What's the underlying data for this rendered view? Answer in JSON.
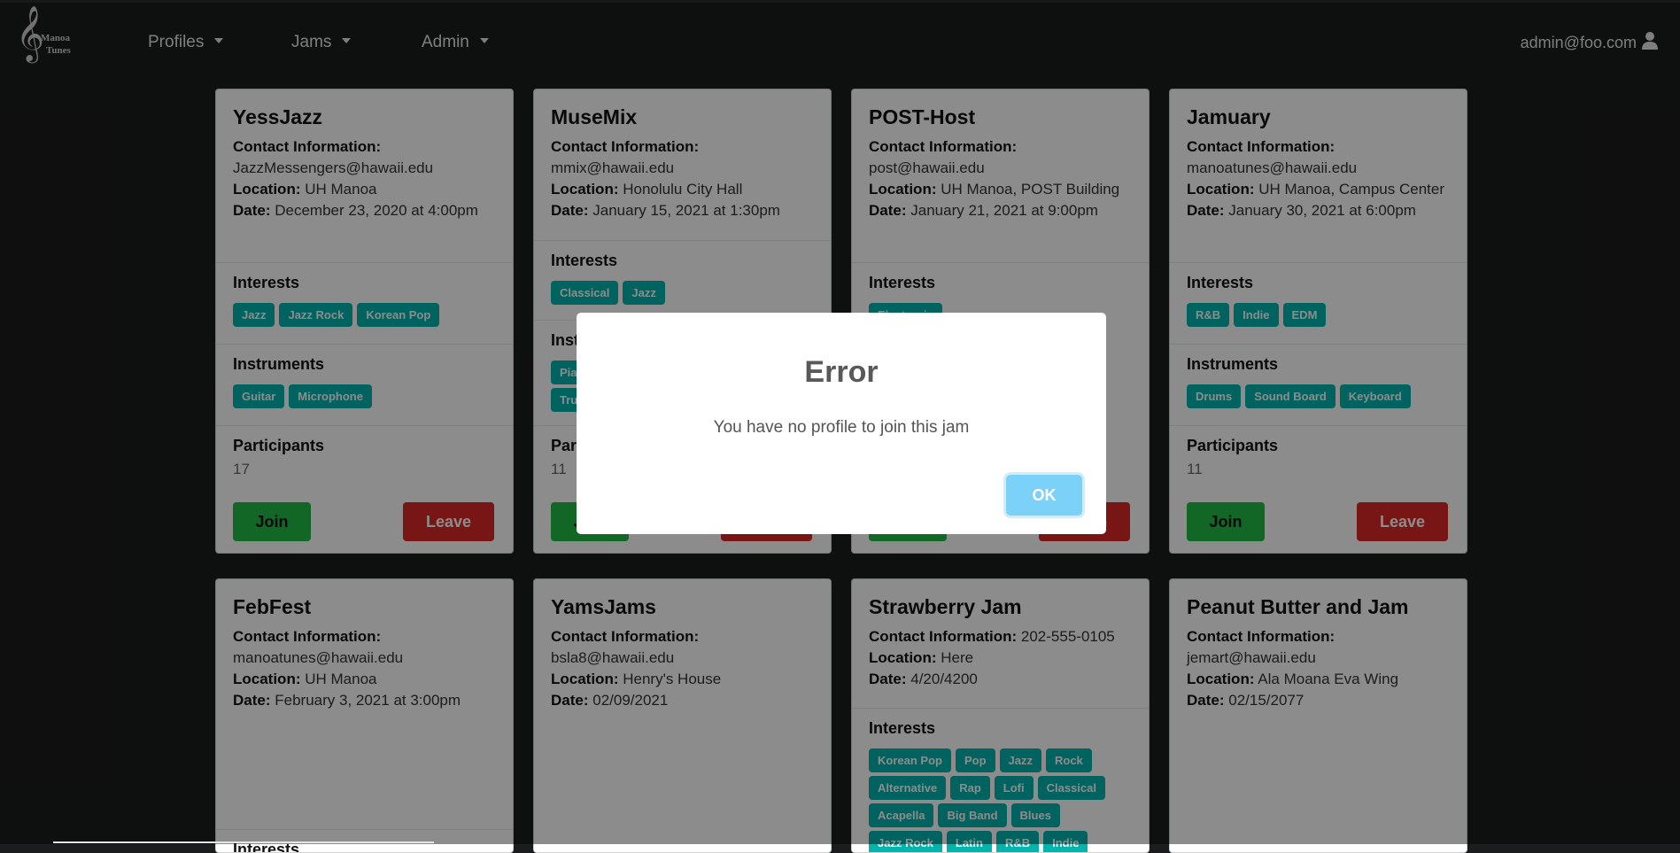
{
  "nav": {
    "logo_line1": "Manoa",
    "logo_line2": "Tunes",
    "items": [
      "Profiles",
      "Jams",
      "Admin"
    ],
    "user": "admin@foo.com"
  },
  "labels": {
    "contact": "Contact Information:",
    "location": "Location:",
    "date": "Date:",
    "interests": "Interests",
    "instruments": "Instruments",
    "participants": "Participants",
    "join": "Join",
    "leave": "Leave"
  },
  "jams": [
    {
      "name": "YessJazz",
      "contact": "JazzMessengers@hawaii.edu",
      "location": "UH Manoa",
      "date": "December 23, 2020 at 4:00pm",
      "interests": [
        "Jazz",
        "Jazz Rock",
        "Korean Pop"
      ],
      "instruments": [
        "Guitar",
        "Microphone"
      ],
      "participants": "17"
    },
    {
      "name": "MuseMix",
      "contact": "mmix@hawaii.edu",
      "location": "Honolulu City Hall",
      "date": "January 15, 2021 at 1:30pm",
      "interests": [
        "Classical",
        "Jazz"
      ],
      "instruments": [
        "Piano",
        "Trumpet"
      ],
      "participants": "11"
    },
    {
      "name": "POST-Host",
      "contact": "post@hawaii.edu",
      "location": "UH Manoa, POST Building",
      "date": "January 21, 2021 at 9:00pm",
      "interests": [
        "Electronic"
      ],
      "instruments": [],
      "participants": ""
    },
    {
      "name": "Jamuary",
      "contact": "manoatunes@hawaii.edu",
      "location": "UH Manoa, Campus Center",
      "date": "January 30, 2021 at 6:00pm",
      "interests": [
        "R&B",
        "Indie",
        "EDM"
      ],
      "instruments": [
        "Drums",
        "Sound Board",
        "Keyboard"
      ],
      "participants": "11"
    },
    {
      "name": "FebFest",
      "contact": "manoatunes@hawaii.edu",
      "location": "UH Manoa",
      "date": "February 3, 2021 at 3:00pm",
      "interests": []
    },
    {
      "name": "YamsJams",
      "contact": "bsla8@hawaii.edu",
      "location": "Henry's House",
      "date": "02/09/2021",
      "interests": []
    },
    {
      "name": "Strawberry Jam",
      "contact": "202-555-0105",
      "location": "Here",
      "date": "4/20/4200",
      "interests": [
        "Korean Pop",
        "Pop",
        "Jazz",
        "Rock",
        "Alternative",
        "Rap",
        "Lofi",
        "Classical",
        "Acapella",
        "Big Band",
        "Blues",
        "Jazz Rock",
        "Latin",
        "R&B",
        "Indie"
      ]
    },
    {
      "name": "Peanut Butter and Jam",
      "contact": "jemart@hawaii.edu",
      "location": "Ala Moana Eva Wing",
      "date": "02/15/2077",
      "interests": []
    }
  ],
  "modal": {
    "title": "Error",
    "message": "You have no profile to join this jam",
    "ok": "OK"
  }
}
